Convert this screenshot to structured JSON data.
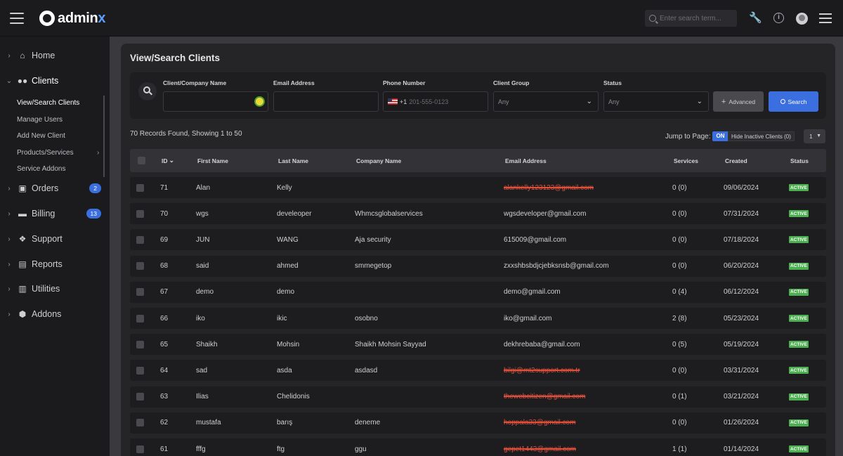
{
  "app": {
    "name_part1": "admin",
    "name_part2": "x"
  },
  "header": {
    "search_placeholder": "Enter search term..."
  },
  "sidebar": {
    "items": [
      {
        "label": "Home",
        "icon": "home-icon"
      },
      {
        "label": "Clients",
        "icon": "users-icon"
      },
      {
        "label": "Orders",
        "icon": "cart-icon",
        "badge": "2"
      },
      {
        "label": "Billing",
        "icon": "card-icon",
        "badge": "13"
      },
      {
        "label": "Support",
        "icon": "lifebuoy-icon"
      },
      {
        "label": "Reports",
        "icon": "chart-icon"
      },
      {
        "label": "Utilities",
        "icon": "file-icon"
      },
      {
        "label": "Addons",
        "icon": "cube-icon"
      }
    ],
    "clients_sub": [
      "View/Search Clients",
      "Manage Users",
      "Add New Client",
      "Products/Services",
      "Service Addons"
    ]
  },
  "page": {
    "title": "View/Search Clients",
    "filters": {
      "name_label": "Client/Company Name",
      "email_label": "Email Address",
      "phone_label": "Phone Number",
      "phone_code": "+1",
      "phone_placeholder": "201-555-0123",
      "group_label": "Client Group",
      "group_value": "Any",
      "status_label": "Status",
      "status_value": "Any",
      "advanced_label": "Advanced",
      "search_label": "Search"
    },
    "records_text": "70 Records Found, Showing 1 to 50",
    "jump_label": "Jump to Page:",
    "toggle_label": "ON",
    "hide_inactive_label": "Hide Inactive Clients (0)",
    "page_value": "1"
  },
  "table": {
    "headers": [
      "ID",
      "First Name",
      "Last Name",
      "Company Name",
      "Email Address",
      "Services",
      "Created",
      "Status"
    ],
    "rows": [
      {
        "id": "71",
        "first": "Alan",
        "last": "Kelly",
        "company": "",
        "email": "alankelly123123@gmail.com",
        "services": "0 (0)",
        "created": "09/06/2024",
        "status": "ACTIVE",
        "redacted": true
      },
      {
        "id": "70",
        "first": "wgs",
        "last": "develeoper",
        "company": "Whmcsglobalservices",
        "email": "wgsdeveloper@gmail.com",
        "services": "0 (0)",
        "created": "07/31/2024",
        "status": "ACTIVE",
        "redacted": false
      },
      {
        "id": "69",
        "first": "JUN",
        "last": "WANG",
        "company": "Aja security",
        "email": "615009@gmail.com",
        "services": "0 (0)",
        "created": "07/18/2024",
        "status": "ACTIVE",
        "redacted": false
      },
      {
        "id": "68",
        "first": "said",
        "last": "ahmed",
        "company": "smmegetop",
        "email": "zxxshbsbdjcjebksnsb@gmail.com",
        "services": "0 (0)",
        "created": "06/20/2024",
        "status": "ACTIVE",
        "redacted": false
      },
      {
        "id": "67",
        "first": "demo",
        "last": "demo",
        "company": "",
        "email": "demo@gmail.com",
        "services": "0 (4)",
        "created": "06/12/2024",
        "status": "ACTIVE",
        "redacted": false
      },
      {
        "id": "66",
        "first": "iko",
        "last": "ikic",
        "company": "osobno",
        "email": "iko@gmail.com",
        "services": "2 (8)",
        "created": "05/23/2024",
        "status": "ACTIVE",
        "redacted": false
      },
      {
        "id": "65",
        "first": "Shaikh",
        "last": "Mohsin",
        "company": "Shaikh Mohsin Sayyad",
        "email": "dekhrebaba@gmail.com",
        "services": "0 (5)",
        "created": "05/19/2024",
        "status": "ACTIVE",
        "redacted": false
      },
      {
        "id": "64",
        "first": "sad",
        "last": "asda",
        "company": "asdasd",
        "email": "bilgi@mt2support.com.tr",
        "services": "0 (0)",
        "created": "03/31/2024",
        "status": "ACTIVE",
        "redacted": true
      },
      {
        "id": "63",
        "first": "Ilias",
        "last": "Chelidonis",
        "company": "",
        "email": "thewebcitizen@gmail.com",
        "services": "0 (1)",
        "created": "03/21/2024",
        "status": "ACTIVE",
        "redacted": true
      },
      {
        "id": "62",
        "first": "mustafa",
        "last": "barış",
        "company": "deneme",
        "email": "hoppala33@gmail.com",
        "services": "0 (0)",
        "created": "01/26/2024",
        "status": "ACTIVE",
        "redacted": true
      },
      {
        "id": "61",
        "first": "fffg",
        "last": "ftg",
        "company": "ggu",
        "email": "gepet1443@gmail.com",
        "services": "1 (1)",
        "created": "01/14/2024",
        "status": "ACTIVE",
        "redacted": true
      }
    ]
  }
}
